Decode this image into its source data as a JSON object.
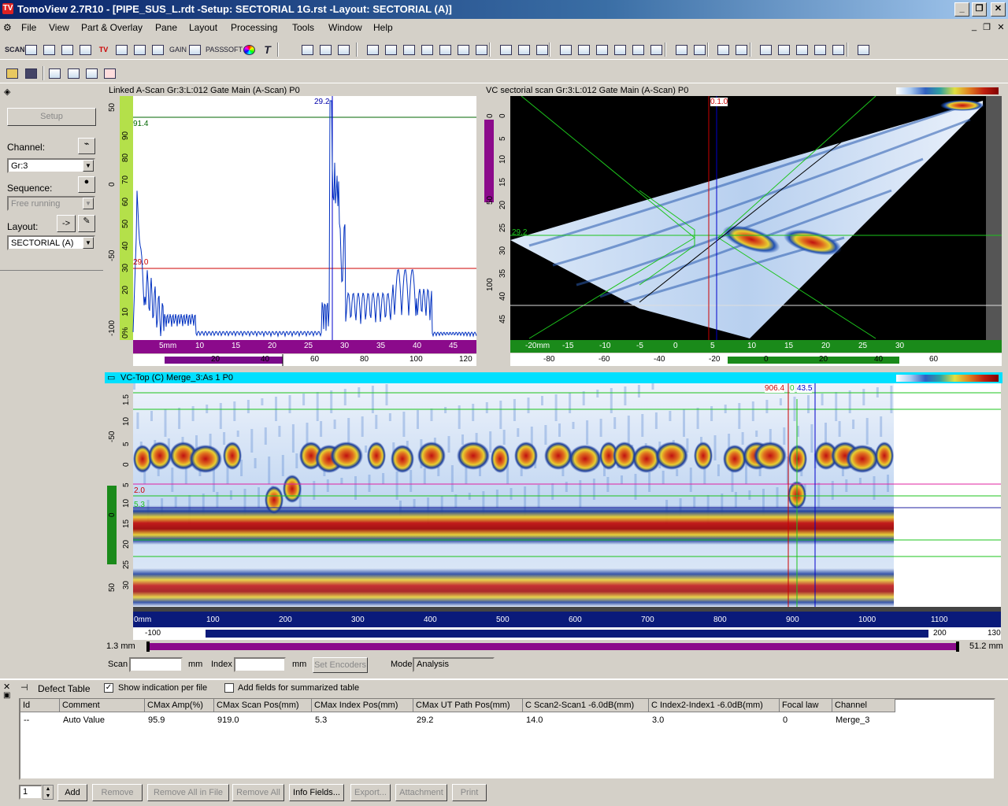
{
  "window": {
    "title": "TomoView 2.7R10 - [PIPE_SUS_L.rdt -Setup: SECTORIAL 1G.rst -Layout: SECTORIAL (A)]",
    "logo_text": "TV"
  },
  "menu": [
    "File",
    "View",
    "Part & Overlay",
    "Pane",
    "Layout",
    "Processing",
    "Tools",
    "Window",
    "Help"
  ],
  "toolbar": {
    "tool_texts": [
      "SCAN",
      "TV",
      "GAIN",
      "PASS",
      "SOFT",
      "T"
    ],
    "icons": [
      "scan-icon",
      "table-icon",
      "gain-icon",
      "tv-icon",
      "color-icon",
      "text-icon",
      "zoom-icon",
      "cursor-icon",
      "layout-icon"
    ]
  },
  "left_panel": {
    "setup_label": "Setup",
    "channel_label": "Channel:",
    "channel_value": "Gr:3",
    "sequence_label": "Sequence:",
    "sequence_value": "Free running",
    "layout_label": "Layout:",
    "layout_value": "SECTORIAL (A)",
    "arrow_btn": "->"
  },
  "ascan": {
    "title": "Linked A-Scan Gr:3:L:012 Gate Main (A-Scan) P0",
    "peak_label": "29.2",
    "level_label": "91.4",
    "gate_label": "29.0",
    "x_ticks": [
      "5mm",
      "10",
      "15",
      "20",
      "25",
      "30",
      "35",
      "40",
      "45"
    ],
    "x2_ticks": [
      "20",
      "40",
      "60",
      "80",
      "100",
      "120"
    ],
    "y_ticks": [
      "0%",
      "10",
      "20",
      "30",
      "40",
      "50",
      "60",
      "70",
      "80",
      "90"
    ],
    "y_left_ticks": [
      "-100",
      "-50",
      "0",
      "50"
    ]
  },
  "sectorial": {
    "title": "VC sectorial scan Gr:3:L:012 Gate Main (A-Scan) P0",
    "cursor_label": "0.1.0",
    "depth_label": "29.2",
    "x_ticks": [
      "-20mm",
      "-15",
      "-10",
      "-5",
      "0",
      "5",
      "10",
      "15",
      "20",
      "25",
      "30"
    ],
    "x2_ticks": [
      "-80",
      "-60",
      "-40",
      "-20",
      "0",
      "20",
      "40",
      "60"
    ],
    "y_ticks": [
      "0",
      "5",
      "10",
      "15",
      "20",
      "25",
      "30",
      "35",
      "40",
      "45"
    ],
    "y_left_ticks": [
      "0",
      "50",
      "100"
    ]
  },
  "cscan": {
    "title": "VC-Top (C) Merge_3:As 1 P0",
    "cursor1_label": "906.4",
    "cursor2_label": "43.5",
    "cursor2_prefix": "0",
    "h1_label": "2.0",
    "h2_label": "5.3",
    "x_ticks": [
      "0mm",
      "100",
      "200",
      "300",
      "400",
      "500",
      "600",
      "700",
      "800",
      "900",
      "1000",
      "1100"
    ],
    "x2_ticks": [
      "-100",
      "200",
      "130"
    ],
    "y_ticks": [
      "-50",
      "0",
      "50"
    ],
    "y_inner_ticks": [
      "1.5",
      "10",
      "5",
      "0",
      "5",
      "10",
      "15",
      "20",
      "25",
      "30"
    ],
    "range_left": "1.3 mm",
    "range_right": "51.2 mm"
  },
  "scanbar": {
    "scan_label": "Scan",
    "index_label": "Index",
    "mm1": "mm",
    "mm2": "mm",
    "set_encoders": "Set Encoders",
    "mode_label": "Mode",
    "mode_value": "Analysis"
  },
  "defect_table": {
    "title": "Defect Table",
    "show_indication": "Show indication per file",
    "add_fields": "Add fields for summarized table",
    "columns": [
      "Id",
      "Comment",
      "CMax Amp(%)",
      "CMax Scan Pos(mm)",
      "CMax Index Pos(mm)",
      "CMax UT Path Pos(mm)",
      "C Scan2-Scan1 -6.0dB(mm)",
      "C Index2-Index1 -6.0dB(mm)",
      "Focal law",
      "Channel"
    ],
    "rows": [
      [
        "--",
        "Auto Value",
        "95.9",
        "919.0",
        "5.3",
        "29.2",
        "14.0",
        "3.0",
        "0",
        "Merge_3"
      ]
    ],
    "spinner_value": "1",
    "buttons": [
      "Add",
      "Remove",
      "Remove All in File",
      "Remove All",
      "Info Fields...",
      "Export...",
      "Attachment",
      "Print"
    ]
  }
}
